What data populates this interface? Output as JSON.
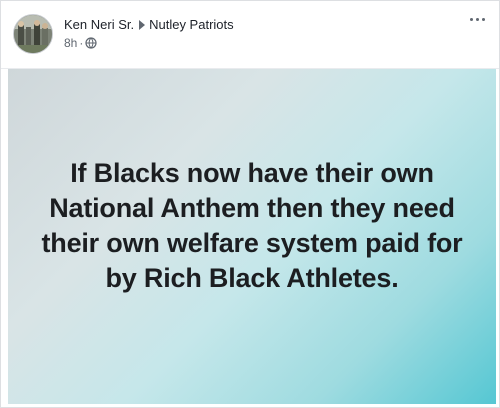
{
  "post": {
    "author": "Ken Neri Sr.",
    "group": "Nutley Patriots",
    "timestamp": "8h",
    "separator": "·",
    "privacy_icon": "globe-icon",
    "more_icon": "ellipsis-icon",
    "message": "If Blacks now have their own National Anthem then they need their own welfare system paid for by Rich Black Athletes.",
    "colors": {
      "text": "#1c1e21",
      "meta": "#606770",
      "background_gradient": [
        "#55c7d3",
        "#c5e7ea",
        "#cfd7da"
      ]
    }
  }
}
